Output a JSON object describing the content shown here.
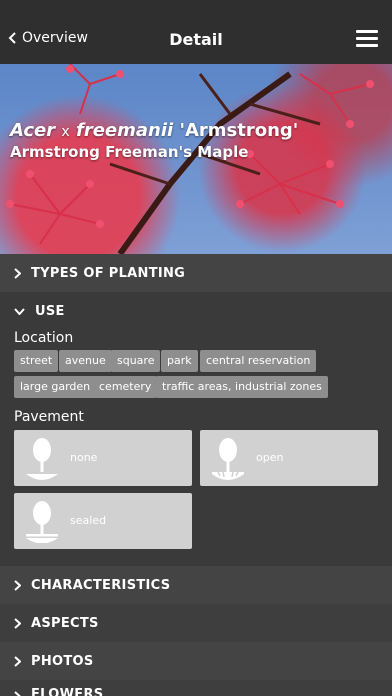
{
  "header": {
    "back_label": "Overview",
    "title": "Detail"
  },
  "hero": {
    "genus": "Acer",
    "hybrid": "x",
    "species": "freemanii",
    "cultivar": "'Armstrong'",
    "common_name": "Armstrong Freeman's Maple"
  },
  "sections": {
    "types_of_planting": "TYPES OF PLANTING",
    "use": "USE",
    "characteristics": "CHARACTERISTICS",
    "aspects": "ASPECTS",
    "photos": "PHOTOS",
    "flowers": "FLOWERS"
  },
  "use": {
    "location_label": "Location",
    "locations": [
      "street",
      "avenue",
      "square",
      "park",
      "central reservation",
      "large garden",
      "cemetery",
      "traffic areas, industrial zones"
    ],
    "pavement_label": "Pavement",
    "pavements": [
      "none",
      "open",
      "sealed"
    ]
  }
}
